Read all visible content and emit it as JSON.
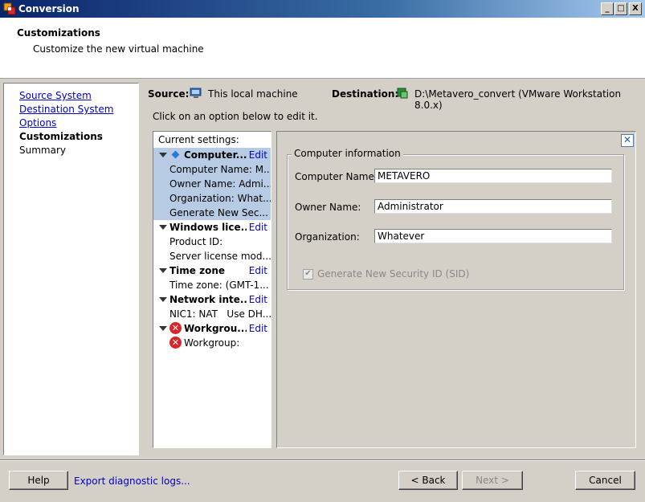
{
  "window": {
    "title": "Conversion",
    "controls": {
      "minimize": "_",
      "maximize": "□",
      "close": "X"
    }
  },
  "header": {
    "title": "Customizations",
    "subtitle": "Customize the new virtual machine"
  },
  "nav": {
    "items": [
      {
        "label": "Source System",
        "state": "link"
      },
      {
        "label": "Destination System",
        "state": "link"
      },
      {
        "label": "Options",
        "state": "link"
      },
      {
        "label": "Customizations",
        "state": "current"
      },
      {
        "label": "Summary",
        "state": "plain"
      }
    ]
  },
  "source": {
    "label": "Source:",
    "value": "This local machine",
    "icon": "computer-icon"
  },
  "destination": {
    "label": "Destination:",
    "value": "D:\\Metavero_convert (VMware Workstation 8.0.x)",
    "icon": "vm-icon"
  },
  "instruction": "Click on an option below to edit it.",
  "tree": {
    "heading": "Current settings:",
    "edit_label": "Edit",
    "groups": [
      {
        "label": "Computer...",
        "icon": "diamond-icon",
        "selected": true,
        "values": [
          "Computer Name: M...",
          "Owner Name: Admi...",
          "Organization: What...",
          "Generate New Sec..."
        ]
      },
      {
        "label": "Windows lice...",
        "values": [
          "Product ID:",
          "Server license mod..."
        ]
      },
      {
        "label": "Time zone",
        "values": [
          "Time zone: (GMT-1..."
        ]
      },
      {
        "label": "Network inte...",
        "values": [
          "NIC1: NAT   Use DH..."
        ]
      },
      {
        "label": "Workgrou...",
        "icon": "error-icon",
        "values": [
          "Workgroup:"
        ]
      }
    ]
  },
  "editor": {
    "group_title": "Computer information",
    "fields": [
      {
        "label": "Computer Name:",
        "value": "METAVERO"
      },
      {
        "label": "Owner Name:",
        "value": "Administrator"
      },
      {
        "label": "Organization:",
        "value": "Whatever"
      }
    ],
    "sid_checkbox": {
      "label": "Generate New Security ID (SID)",
      "checked": true,
      "enabled": false
    },
    "close_glyph": "✕"
  },
  "buttons": {
    "help": "Help",
    "export_logs": "Export diagnostic logs...",
    "back": "< Back",
    "next": "Next >",
    "cancel": "Cancel"
  },
  "colors": {
    "titlebar": "#0a246a",
    "selection": "#b8cbe4",
    "link": "#0000cc",
    "error": "#d9262a"
  }
}
